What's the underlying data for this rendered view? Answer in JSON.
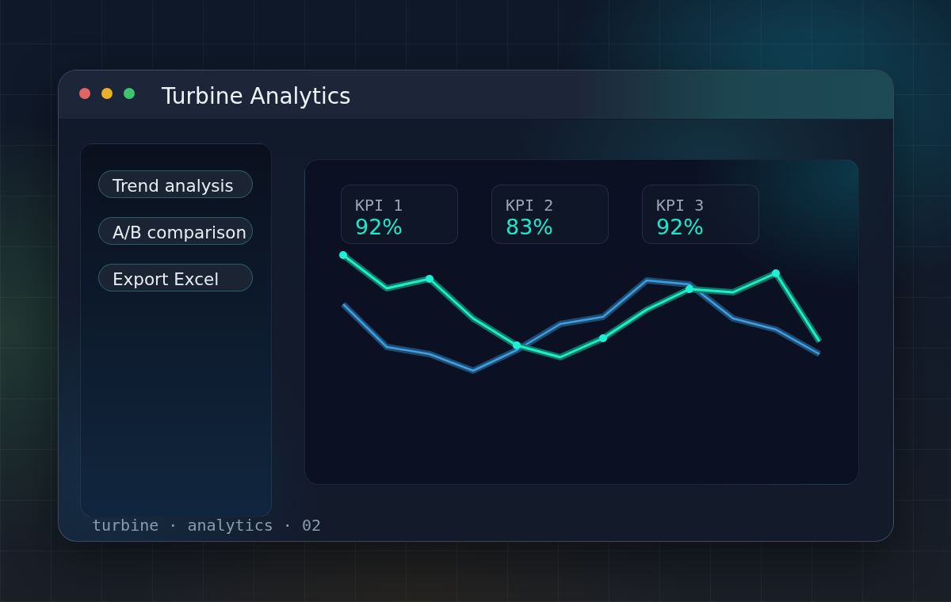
{
  "window": {
    "title": "Turbine Analytics",
    "controls": [
      {
        "color": "#e06666"
      },
      {
        "color": "#e8b126"
      },
      {
        "color": "#3cc46e"
      }
    ]
  },
  "sidebar": {
    "items": [
      {
        "label": "Trend analysis"
      },
      {
        "label": "A/B comparison"
      },
      {
        "label": "Export Excel"
      }
    ]
  },
  "kpis": [
    {
      "label": "KPI 1",
      "value": "92%"
    },
    {
      "label": "KPI 2",
      "value": "83%"
    },
    {
      "label": "KPI 3",
      "value": "92%"
    }
  ],
  "footer": "turbine · analytics · 02"
}
